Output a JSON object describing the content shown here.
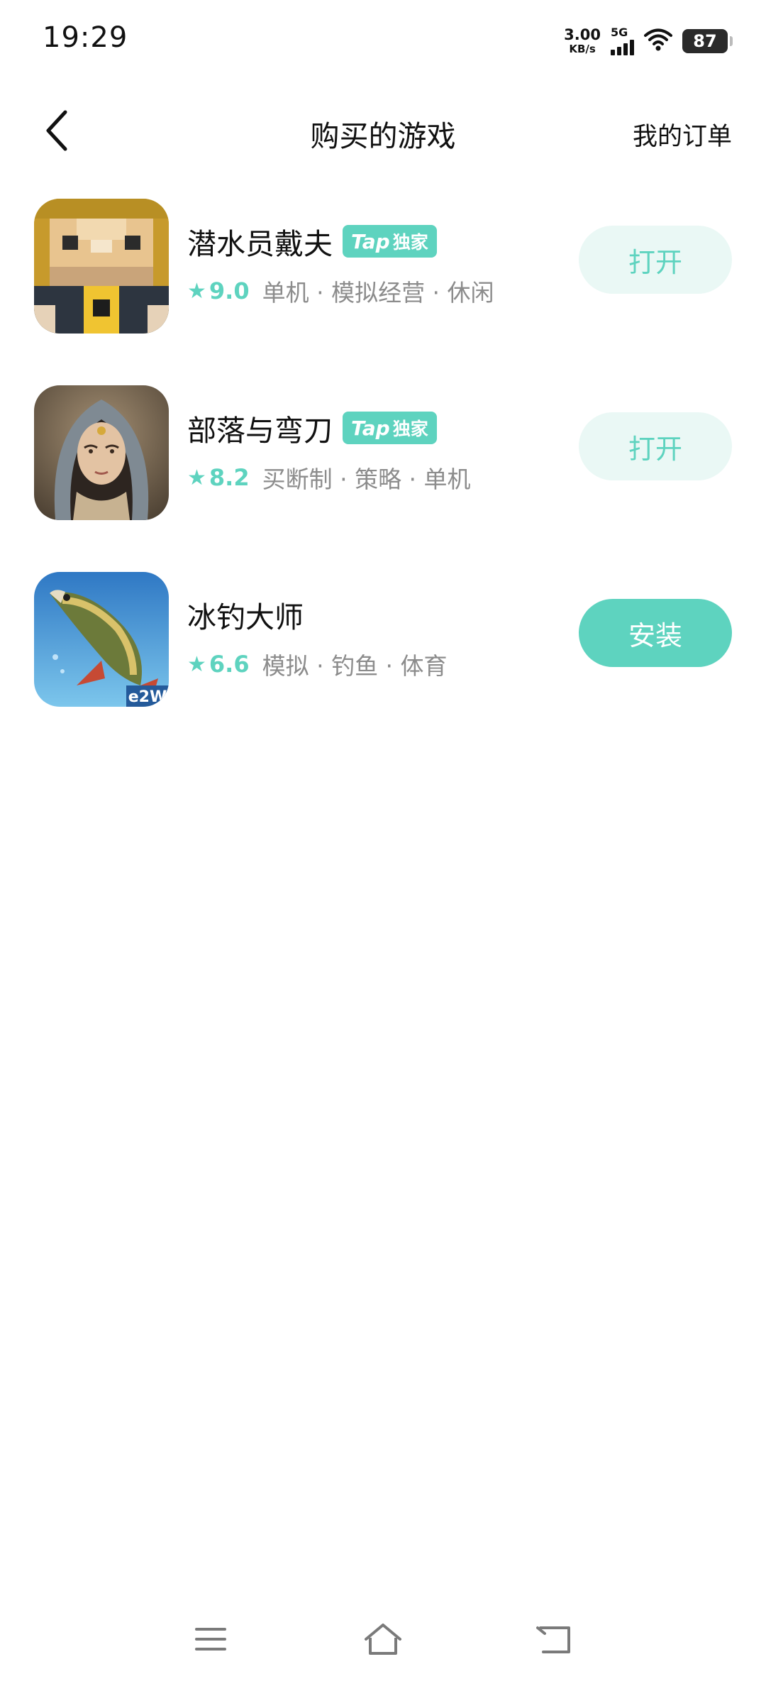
{
  "status_bar": {
    "time": "19:29",
    "net_speed_value": "3.00",
    "net_speed_unit": "KB/s",
    "network_type": "5G",
    "battery_level": "87"
  },
  "app_bar": {
    "back_icon": "chevron-left-icon",
    "title": "购买的游戏",
    "orders_label": "我的订单"
  },
  "colors": {
    "accent": "#5ed3bf",
    "accent_light_bg": "#eaf8f5",
    "tag_gray": "#8c8c8c"
  },
  "games": [
    {
      "name": "潜水员戴夫",
      "badge": {
        "brand": "Tap",
        "text": "独家"
      },
      "rating": "9.0",
      "tags": "单机 · 模拟经营 · 休闲",
      "action_label": "打开",
      "action_style": "light"
    },
    {
      "name": "部落与弯刀",
      "badge": {
        "brand": "Tap",
        "text": "独家"
      },
      "rating": "8.2",
      "tags": "买断制 · 策略 · 单机",
      "action_label": "打开",
      "action_style": "light"
    },
    {
      "name": "冰钓大师",
      "badge": null,
      "rating": "6.6",
      "tags": "模拟 · 钓鱼 · 体育",
      "action_label": "安装",
      "action_style": "solid",
      "icon_caption": "e2W"
    }
  ],
  "nav_bar": {
    "menu_icon": "menu-icon",
    "home_icon": "home-icon",
    "back_icon": "back-arrow-icon"
  }
}
